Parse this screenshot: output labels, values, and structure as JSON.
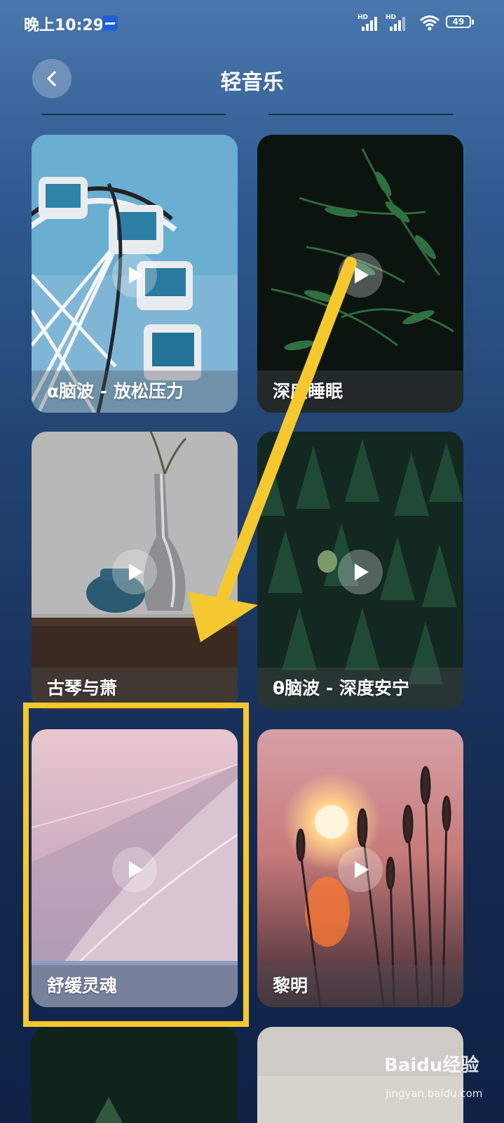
{
  "status": {
    "time": "晚上10:29",
    "battery": "49",
    "network_tag": "HD"
  },
  "header": {
    "title": "轻音乐"
  },
  "cards": [
    {
      "label": "α脑波 - 放松压力"
    },
    {
      "label": "深度睡眠"
    },
    {
      "label": "古琴与萧"
    },
    {
      "label": "θ脑波 - 深度安宁"
    },
    {
      "label": "舒缓灵魂"
    },
    {
      "label": "黎明"
    }
  ],
  "watermark": {
    "brand": "Baidu经验",
    "url": "jingyan.baidu.com"
  },
  "colors": {
    "highlight": "#f6c830",
    "background_top": "#4a77ad",
    "background_bottom": "#0f2246"
  }
}
